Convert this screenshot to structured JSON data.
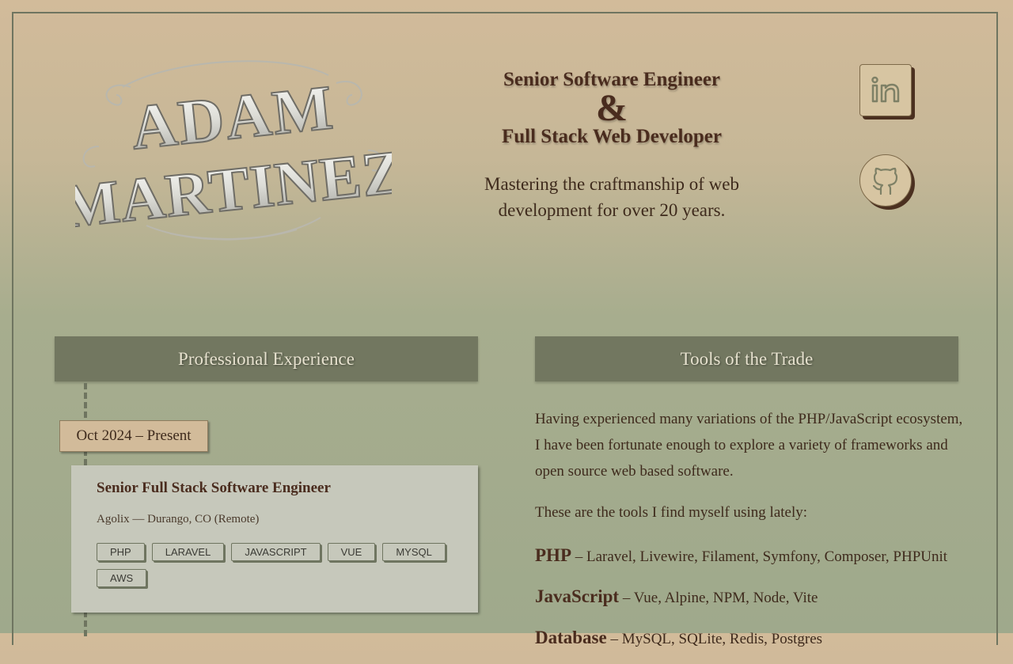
{
  "header": {
    "logo_line1": "ADAM",
    "logo_line2": "MARTINEZ",
    "title_line1": "Senior Software Engineer",
    "title_amp": "&",
    "title_line2": "Full Stack Web Developer",
    "tagline": "Mastering the craftmanship of web development for over 20 years."
  },
  "social": [
    {
      "name": "LinkedIn",
      "icon": "linkedin-icon"
    },
    {
      "name": "GitHub",
      "icon": "github-icon"
    }
  ],
  "experience": {
    "heading": "Professional Experience",
    "jobs": [
      {
        "date": "Oct 2024 – Present",
        "title": "Senior Full Stack Software Engineer",
        "company": "Agolix — Durango, CO (Remote)",
        "tags": [
          "PHP",
          "LARAVEL",
          "JAVASCRIPT",
          "VUE",
          "MYSQL",
          "AWS"
        ]
      }
    ]
  },
  "tools": {
    "heading": "Tools of the Trade",
    "intro": "Having experienced many variations of the PHP/JavaScript ecosystem, I have been fortunate enough to explore a variety of frameworks and open source web based software.",
    "lead": "These are the tools I find myself using lately:",
    "categories": [
      {
        "name": "PHP",
        "items": "– Laravel, Livewire, Filament, Symfony, Composer, PHPUnit"
      },
      {
        "name": "JavaScript",
        "items": "– Vue, Alpine, NPM, Node, Vite"
      },
      {
        "name": "Database",
        "items": "– MySQL, SQLite, Redis, Postgres"
      }
    ]
  },
  "colors": {
    "accent_dark": "#4a2c1e",
    "panel_green": "#727760",
    "parchment": "#d2bb9a"
  }
}
